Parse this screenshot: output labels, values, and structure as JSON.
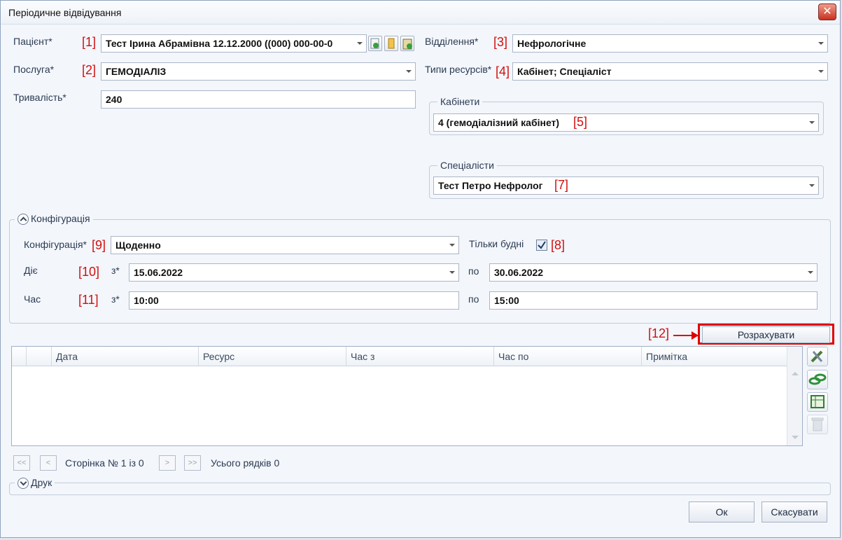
{
  "window": {
    "title": "Періодичне відвідування"
  },
  "icons": {
    "close": "close-icon",
    "patient_buttons": [
      "patient-add-icon",
      "patient-card-icon",
      "patient-document-icon"
    ],
    "side_tools": [
      "tools-icon",
      "link-icon",
      "table-icon",
      "trash-icon"
    ]
  },
  "colors": {
    "annotation": "#d01010",
    "highlight_border": "#e00000"
  },
  "form": {
    "patient": {
      "label": "Пацієнт*",
      "mark": "[1]",
      "value": "Тест Ірина Абрамівна 12.12.2000 ((000) 000-00-0"
    },
    "service": {
      "label": "Послуга*",
      "mark": "[2]",
      "value": "ГЕМОДІАЛІЗ"
    },
    "duration": {
      "label": "Тривалість*",
      "value": "240"
    },
    "department": {
      "label": "Відділення*",
      "mark": "[3]",
      "value": "Нефрологічне"
    },
    "resource_types": {
      "label": "Типи ресурсів*",
      "mark": "[4]",
      "value": "Кабінет; Спеціаліст"
    },
    "cabinets": {
      "legend": "Кабінети",
      "value": "4 (гемодіалізний кабінет)",
      "mark": "[5]"
    },
    "specialists": {
      "legend": "Спеціалісти",
      "value": "Тест Петро Нефролог",
      "mark": "[7]"
    }
  },
  "configuration": {
    "legend": "Конфігурація",
    "config": {
      "label": "Конфігурація*",
      "mark": "[9]",
      "value": "Щоденно"
    },
    "weekdays_only": {
      "label": "Тільки будні",
      "checked": true,
      "mark": "[8]"
    },
    "active": {
      "label": "Діє",
      "mark": "[10]",
      "from_label": "з*",
      "from": "15.06.2022",
      "to_label": "по",
      "to": "30.06.2022"
    },
    "time": {
      "label": "Час",
      "mark": "[11]",
      "from_label": "з*",
      "from": "10:00",
      "to_label": "по",
      "to": "15:00"
    }
  },
  "calculate": {
    "label": "Розрахувати",
    "mark": "[12]"
  },
  "grid": {
    "columns": [
      "Дата",
      "Ресурс",
      "Час з",
      "Час по",
      "Примітка"
    ],
    "rows": []
  },
  "pager": {
    "first": "<<",
    "prev": "<",
    "next": ">",
    "last": ">>",
    "page_text": "Сторінка № 1 із 0",
    "total_text": "Усього рядків 0"
  },
  "print_section": {
    "legend": "Друк"
  },
  "footer": {
    "ok": "Ок",
    "cancel": "Скасувати"
  }
}
